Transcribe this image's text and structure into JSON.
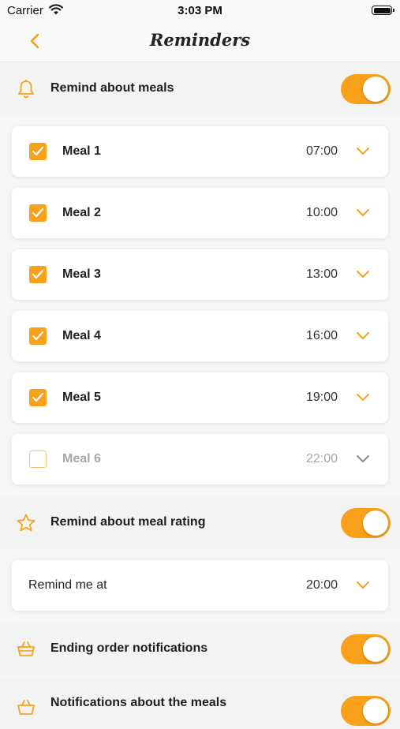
{
  "status_bar": {
    "carrier": "Carrier",
    "time": "3:03 PM"
  },
  "nav": {
    "title": "Reminders"
  },
  "meals_section": {
    "label": "Remind about meals",
    "enabled": true
  },
  "meals": [
    {
      "name": "Meal 1",
      "time": "07:00",
      "checked": true
    },
    {
      "name": "Meal 2",
      "time": "10:00",
      "checked": true
    },
    {
      "name": "Meal 3",
      "time": "13:00",
      "checked": true
    },
    {
      "name": "Meal 4",
      "time": "16:00",
      "checked": true
    },
    {
      "name": "Meal 5",
      "time": "19:00",
      "checked": true
    },
    {
      "name": "Meal 6",
      "time": "22:00",
      "checked": false
    }
  ],
  "rating_section": {
    "label": "Remind about meal rating",
    "enabled": true
  },
  "rating_time": {
    "label": "Remind me at",
    "time": "20:00"
  },
  "ending_section": {
    "label": "Ending order notifications",
    "enabled": true
  },
  "meals_notif_section": {
    "label": "Notifications about the meals",
    "enabled": true
  },
  "colors": {
    "accent": "#f9a11b",
    "disabled": "#a8a8a8"
  }
}
